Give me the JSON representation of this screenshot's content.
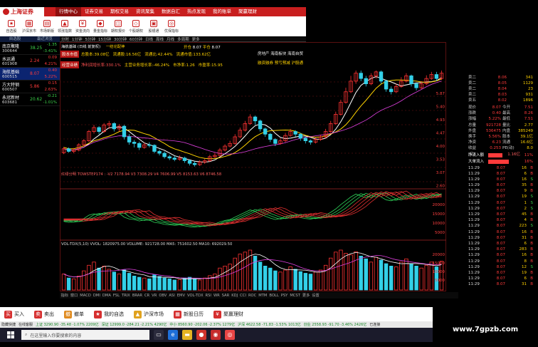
{
  "nav": {
    "logo": "上海证券",
    "menu": [
      "行情中心",
      "证券交易",
      "期权交易",
      "资讯聚集",
      "数据自汇",
      "热点发现",
      "我的账单",
      "聚赢理财"
    ],
    "active": 0
  },
  "icons": [
    "自选股",
    "沪深京市",
    "市场新版",
    "领涨指数",
    "资金流向",
    "量金指标",
    "期权报价",
    "个股期权",
    "股银通",
    "优保指标"
  ],
  "watchlist": {
    "tabs": [
      "自选股",
      "最近浏览"
    ],
    "items": [
      {
        "name": "南京聚隆",
        "code": "300644",
        "price": "38.25",
        "chg": "-1.35",
        "pct": "-3.41%",
        "dir": "dn"
      },
      {
        "name": "水运通",
        "code": "601908",
        "price": "2.24",
        "chg": "0.09",
        "pct": "4.21%",
        "dir": "up"
      },
      {
        "name": "海航基础",
        "code": "600515",
        "price": "8.07",
        "chg": "0.40",
        "pct": "5.22%",
        "dir": "up",
        "selected": true
      },
      {
        "name": "方大特钢",
        "code": "600507",
        "price": "5.86",
        "chg": "0.15",
        "pct": "2.63%",
        "dir": "up"
      },
      {
        "name": "永冠新材",
        "code": "603681",
        "price": "20.62",
        "chg": "-0.21",
        "pct": "-1.01%",
        "dir": "dn"
      }
    ]
  },
  "timeframes": [
    "分时",
    "1分钟",
    "5分钟",
    "15分钟",
    "30分钟",
    "60分钟",
    "日线",
    "周线",
    "月线",
    "多周期",
    "更多"
  ],
  "chart_header": {
    "stock": "海航基础 (日线 前复权)",
    "indicators": "一结论配神",
    "right_marks": [
      "开仓",
      "8.07",
      "平仓",
      "8.07"
    ]
  },
  "info": {
    "row1_tag": "股本市值",
    "row1": [
      "总股本:39.08亿",
      "流通股:16.56亿",
      "流通比:42.44%",
      "流通市值:133.62亿"
    ],
    "row2_tag": "经营业绩",
    "row2": [
      "净利润增长率:330.1%",
      "主营业务增长率:-46.24%",
      "市净率:1.26",
      "市盈率:15.95"
    ],
    "right1": "房地产 海南板块 海南自贸 一带",
    "right2": "融资融券 预亏预减 沪股通 深股通 股权"
  },
  "price_axis": [
    "5.87",
    "5.40",
    "4.93",
    "4.47",
    "4.00",
    "3.53",
    "3.07",
    "2.60"
  ],
  "ind_label": "红绿分明 TOWSTEP174 : -V2 7178.94  V3 7308.29  V4 7606.99  V5 8153.63  V6 8746.58",
  "ind_axis": [
    "20000",
    "15000",
    "10000",
    "5000"
  ],
  "vol_label": "VOL-TDX(5,10)  VVOL: 1820975.00  VOLUME: 921728.00  MA5: 751602.50  MA10: 692029.50",
  "vol_axis": [
    "20000",
    "15000",
    "10000",
    "5000"
  ],
  "quote": {
    "sells": [
      [
        "卖二",
        "8.06",
        "341"
      ],
      [
        "卖二",
        "8.05",
        "1129"
      ],
      [
        "卖二",
        "8.04",
        "23"
      ],
      [
        "卖二",
        "8.03",
        "931"
      ],
      [
        "卖五",
        "8.02",
        "1896"
      ]
    ],
    "kv": [
      [
        "现价",
        "8.07",
        "今开",
        "7.51"
      ],
      [
        "涨跌",
        "0.40",
        "最高",
        "8.26"
      ],
      [
        "涨幅",
        "5.22%",
        "最低",
        "7.51"
      ],
      [
        "总量",
        "921728",
        "量比",
        "2.77"
      ],
      [
        "外盘",
        "536475",
        "内盘",
        "385249"
      ],
      [
        "换手",
        "5.56%",
        "股本",
        "39.1亿"
      ],
      [
        "净资",
        "6.23",
        "流通",
        "16.6亿"
      ],
      [
        "收益(三)",
        "0.253",
        "PE(动)",
        "8.0"
      ]
    ],
    "flow": [
      [
        "净流入额",
        "1.16亿",
        "11%"
      ],
      [
        "大单流入",
        "",
        "16%"
      ]
    ],
    "ticks": [
      [
        "11:29",
        "8.07",
        "16",
        "B"
      ],
      [
        "11:29",
        "8.07",
        "6",
        "B"
      ],
      [
        "11:29",
        "8.07",
        "16",
        "S"
      ],
      [
        "11:29",
        "8.07",
        "35",
        "B"
      ],
      [
        "11:29",
        "8.07",
        "9",
        "B"
      ],
      [
        "11:29",
        "8.07",
        "19",
        "S"
      ],
      [
        "11:29",
        "8.07",
        "1",
        "S"
      ],
      [
        "11:29",
        "8.07",
        "2",
        "S"
      ],
      [
        "11:29",
        "8.07",
        "45",
        "B"
      ],
      [
        "11:29",
        "8.07",
        "4",
        "B"
      ],
      [
        "11:29",
        "8.07",
        "223",
        "S"
      ],
      [
        "11:29",
        "8.07",
        "16",
        "B"
      ],
      [
        "11:29",
        "8.07",
        "31",
        "B"
      ],
      [
        "11:29",
        "8.07",
        "6",
        "B"
      ],
      [
        "11:29",
        "8.07",
        "283",
        "B"
      ],
      [
        "11:29",
        "8.07",
        "16",
        "B"
      ],
      [
        "11:29",
        "8.07",
        "8",
        "B"
      ],
      [
        "11:29",
        "8.07",
        "12",
        "S"
      ],
      [
        "11:29",
        "8.07",
        "19",
        "B"
      ],
      [
        "11:29",
        "8.07",
        "6",
        "B"
      ],
      [
        "11:29",
        "8.07",
        "31",
        "B"
      ]
    ],
    "tabs": [
      "分笔",
      "指标",
      "买卖",
      "成交",
      "关联"
    ]
  },
  "bottom_tabs": [
    "指标",
    "窗口",
    "MACD",
    "DMI",
    "DMA",
    "FSL",
    "TRIX",
    "BRAR",
    "CR",
    "VR",
    "OBV",
    "ASI",
    "EMV",
    "VOL-TDX",
    "RSI",
    "WR",
    "SAR",
    "KDJ",
    "CCI",
    "ROC",
    "MTM",
    "BOLL",
    "PSY",
    "MCST",
    "更多",
    "设置"
  ],
  "toolbar": [
    "买入",
    "卖出",
    "撤单",
    "我的自选",
    "沪深市场",
    "新股日历",
    "聚赢理财"
  ],
  "status": [
    "隐藏快捷",
    "在线客服",
    "上证 3290.90 -35.48 -1.07% 2209亿",
    "深证 12999.0 -284.21 -2.21% 4290亿",
    "中小 8560.90 -202.06 -2.37% 1279亿",
    "沪深 4622.58 -71.83 -1.53% 1013亿",
    "创业 2558.93 -91.70 -3.46% 2426亿",
    "已连接"
  ],
  "winbar": {
    "search_placeholder": "在这里输入你要搜索的内容"
  },
  "watermark": "www.7gpzb.com",
  "chart_data": {
    "type": "candlestick",
    "y_range": [
      2.3,
      6.6
    ],
    "candles": [
      [
        3.5,
        3.65,
        3.72,
        3.45
      ],
      [
        3.65,
        3.55,
        3.7,
        3.5
      ],
      [
        3.55,
        3.6,
        3.68,
        3.48
      ],
      [
        3.6,
        3.8,
        3.86,
        3.55
      ],
      [
        3.8,
        3.95,
        4.02,
        3.75
      ],
      [
        3.95,
        4.3,
        4.36,
        3.9
      ],
      [
        4.3,
        4.45,
        4.55,
        4.22
      ],
      [
        4.45,
        4.3,
        4.5,
        4.2
      ],
      [
        4.3,
        4.55,
        4.62,
        4.25
      ],
      [
        4.55,
        4.6,
        4.7,
        4.4
      ],
      [
        4.6,
        4.4,
        4.65,
        4.3
      ],
      [
        4.4,
        4.5,
        4.58,
        4.3
      ],
      [
        4.5,
        4.1,
        4.55,
        4.0
      ],
      [
        4.1,
        3.9,
        4.2,
        3.8
      ],
      [
        3.9,
        3.85,
        3.98,
        3.7
      ],
      [
        3.85,
        3.7,
        3.92,
        3.6
      ],
      [
        3.7,
        3.8,
        3.88,
        3.65
      ],
      [
        3.8,
        3.78,
        3.9,
        3.7
      ],
      [
        3.78,
        3.55,
        3.82,
        3.48
      ],
      [
        3.55,
        3.48,
        3.62,
        3.4
      ],
      [
        3.48,
        3.35,
        3.55,
        3.28
      ],
      [
        3.35,
        3.3,
        3.42,
        3.22
      ],
      [
        3.3,
        3.25,
        3.38,
        3.18
      ],
      [
        3.25,
        3.3,
        3.4,
        3.2
      ],
      [
        3.3,
        3.2,
        3.35,
        3.12
      ],
      [
        3.2,
        3.1,
        3.25,
        3.02
      ],
      [
        3.1,
        3.05,
        3.18,
        2.98
      ],
      [
        3.05,
        3.15,
        3.22,
        3.0
      ],
      [
        3.15,
        3.2,
        3.28,
        3.08
      ],
      [
        3.2,
        3.35,
        3.42,
        3.15
      ],
      [
        3.35,
        3.4,
        3.5,
        3.3
      ],
      [
        3.4,
        3.6,
        3.68,
        3.35
      ],
      [
        3.6,
        3.75,
        3.82,
        3.55
      ],
      [
        3.75,
        3.85,
        3.95,
        3.7
      ],
      [
        3.85,
        4.1,
        4.2,
        3.8
      ],
      [
        4.1,
        4.35,
        4.45,
        4.05
      ],
      [
        4.35,
        4.6,
        4.7,
        4.3
      ],
      [
        4.6,
        4.85,
        4.95,
        4.55
      ],
      [
        4.85,
        4.7,
        4.9,
        4.55
      ],
      [
        4.7,
        4.4,
        4.75,
        4.3
      ],
      [
        4.4,
        4.2,
        4.45,
        4.1
      ],
      [
        4.2,
        4.0,
        4.25,
        3.9
      ],
      [
        4.0,
        3.85,
        4.05,
        3.75
      ],
      [
        3.85,
        3.95,
        4.05,
        3.8
      ],
      [
        3.95,
        4.15,
        4.25,
        3.9
      ],
      [
        4.15,
        4.3,
        4.4,
        4.1
      ],
      [
        4.3,
        4.2,
        4.35,
        4.1
      ],
      [
        4.2,
        4.05,
        4.25,
        3.95
      ],
      [
        4.05,
        3.95,
        4.1,
        3.85
      ],
      [
        3.95,
        3.9,
        4.0,
        3.8
      ],
      [
        3.9,
        4.0,
        4.08,
        3.85
      ],
      [
        4.0,
        4.1,
        4.18,
        3.95
      ],
      [
        4.1,
        4.3,
        4.4,
        4.05
      ],
      [
        4.3,
        4.6,
        4.7,
        4.25
      ],
      [
        4.6,
        4.95,
        5.05,
        4.55
      ],
      [
        4.95,
        5.4,
        5.5,
        4.9
      ],
      [
        5.4,
        5.8,
        5.95,
        5.35
      ],
      [
        5.8,
        6.2,
        6.4,
        5.75
      ],
      [
        6.2,
        6.5,
        6.6,
        6.1
      ],
      [
        6.5,
        6.3,
        6.6,
        6.2
      ],
      [
        6.3,
        6.1,
        6.4,
        6.0
      ],
      [
        6.1,
        6.4,
        6.5,
        6.05
      ],
      [
        6.4,
        6.55,
        6.6,
        6.3
      ],
      [
        6.55,
        6.2,
        6.6,
        6.1
      ],
      [
        6.2,
        5.9,
        6.25,
        5.8
      ],
      [
        5.9,
        5.8,
        6.0,
        5.7
      ],
      [
        5.8,
        6.0,
        6.1,
        5.75
      ],
      [
        6.0,
        6.2,
        6.35,
        5.95
      ],
      [
        6.2,
        6.4,
        6.5,
        6.15
      ],
      [
        6.4,
        6.1,
        6.45,
        6.0
      ],
      [
        6.1,
        5.95,
        6.15,
        5.85
      ],
      [
        5.95,
        6.1,
        6.2,
        5.9
      ],
      [
        6.1,
        6.3,
        6.42,
        6.05
      ],
      [
        6.3,
        6.45,
        6.55,
        6.25
      ],
      [
        6.45,
        6.3,
        6.55,
        6.2
      ],
      [
        6.3,
        6.5,
        6.6,
        6.25
      ]
    ],
    "volumes": [
      40,
      30,
      28,
      35,
      48,
      62,
      70,
      55,
      60,
      52,
      45,
      40,
      50,
      42,
      35,
      32,
      30,
      28,
      38,
      34,
      30,
      28,
      25,
      26,
      30,
      32,
      28,
      25,
      30,
      36,
      40,
      55,
      60,
      65,
      80,
      90,
      95,
      100,
      85,
      70,
      60,
      55,
      48,
      45,
      50,
      58,
      52,
      46,
      42,
      40,
      45,
      50,
      62,
      80,
      95,
      100,
      92,
      88,
      96,
      85,
      78,
      70,
      82,
      75,
      66,
      60,
      58,
      70,
      78,
      65,
      60,
      55,
      62,
      70,
      58,
      72
    ]
  }
}
